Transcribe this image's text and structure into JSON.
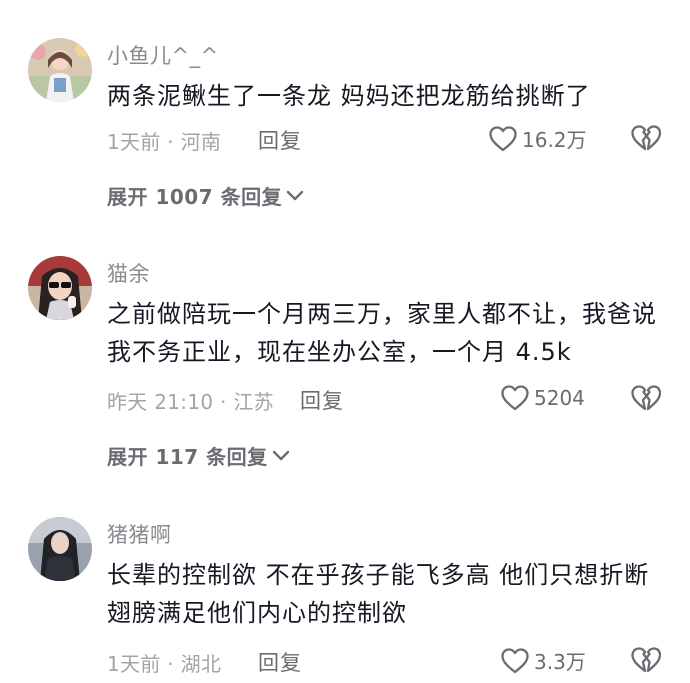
{
  "comments": [
    {
      "username": "小鱼儿^_^",
      "text": "两条泥鳅生了一条龙 妈妈还把龙筋给挑断了",
      "meta": "1天前 · 河南",
      "reply_label": "回复",
      "likes": "16.2万",
      "expand_label": "展开 1007 条回复",
      "like_icon": "heart-outline-icon",
      "dislike_icon": "broken-heart-icon"
    },
    {
      "username": "猫余",
      "text": "之前做陪玩一个月两三万，家里人都不让，我爸说我不务正业，现在坐办公室，一个月 4.5k",
      "meta": "昨天 21:10 · 江苏",
      "reply_label": "回复",
      "likes": "5204",
      "expand_label": "展开 117 条回复",
      "like_icon": "heart-outline-icon",
      "dislike_icon": "broken-heart-icon"
    },
    {
      "username": "猪猪啊",
      "text": "长辈的控制欲 不在乎孩子能飞多高 他们只想折断翅膀满足他们内心的控制欲",
      "meta": "1天前 · 湖北",
      "reply_label": "回复",
      "likes": "3.3万",
      "like_icon": "heart-outline-icon",
      "dislike_icon": "broken-heart-icon"
    }
  ],
  "colors": {
    "primary_text": "#161823",
    "secondary_text": "#8a8b91",
    "meta_text": "#a3a4a8",
    "action_text": "#6b6c72"
  }
}
